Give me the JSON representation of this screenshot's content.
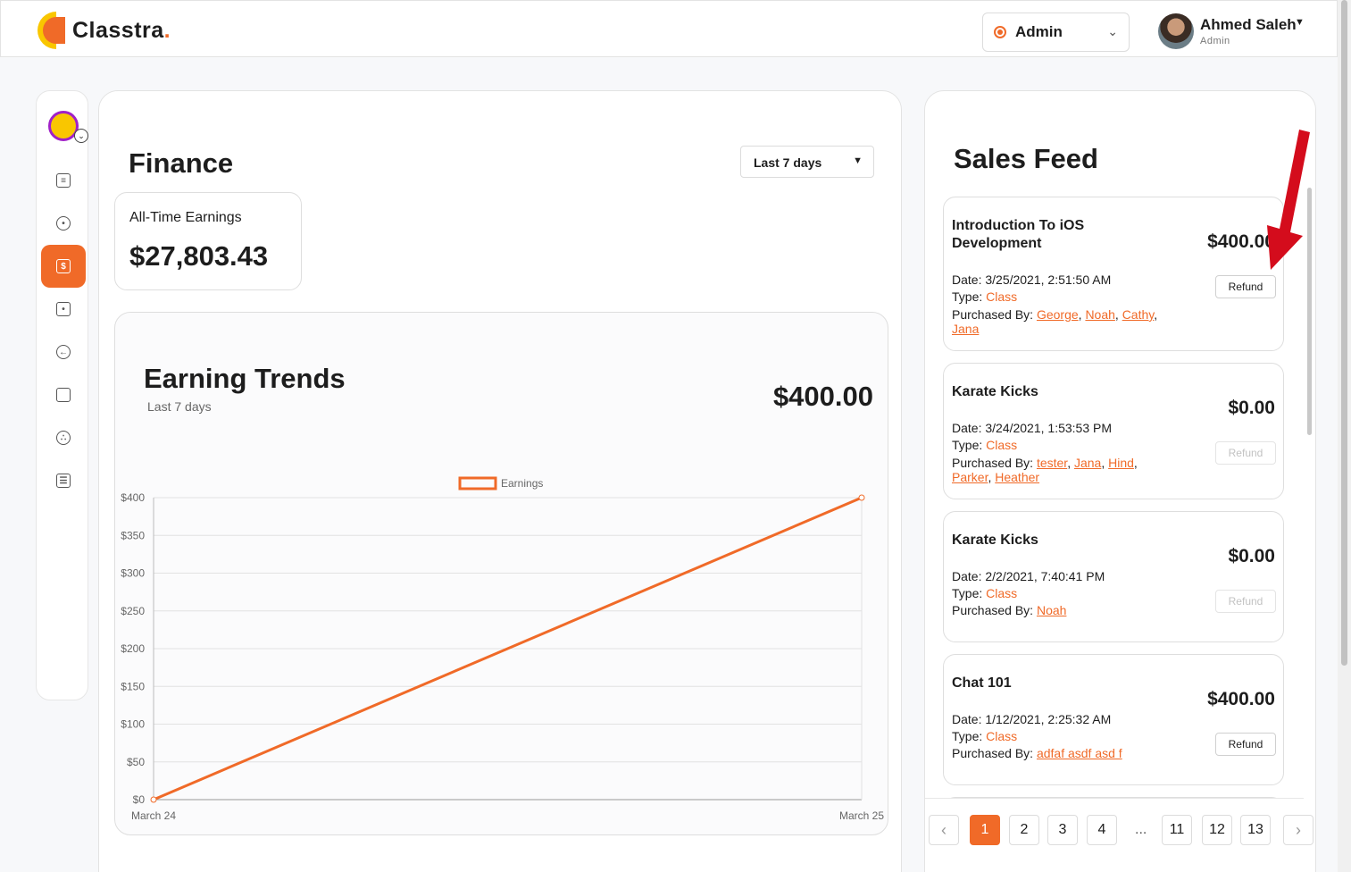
{
  "brand": {
    "name": "Classtra",
    "dot": ".",
    "accent": "#f06a28"
  },
  "header": {
    "role_select": {
      "value": "Admin"
    },
    "user": {
      "name": "Ahmed Saleh",
      "role": "Admin"
    }
  },
  "sidebar": {
    "items": [
      {
        "icon": "book-icon",
        "active": false
      },
      {
        "icon": "user-icon",
        "active": false
      },
      {
        "icon": "dollar-icon",
        "active": true
      },
      {
        "icon": "tag-icon",
        "active": false
      },
      {
        "icon": "logout-icon",
        "active": false
      },
      {
        "icon": "chat-icon",
        "active": false
      },
      {
        "icon": "face-icon",
        "active": false
      },
      {
        "icon": "settings-icon",
        "active": false
      }
    ]
  },
  "finance": {
    "title": "Finance",
    "range": "Last 7 days",
    "all_time": {
      "label": "All-Time Earnings",
      "value": "$27,803.43"
    },
    "trends": {
      "title": "Earning Trends",
      "subtitle": "Last 7 days",
      "total": "$400.00"
    }
  },
  "chart_data": {
    "type": "line",
    "legend": "Earnings",
    "x": [
      "March 24",
      "March 25"
    ],
    "series": [
      {
        "name": "Earnings",
        "values": [
          0,
          400
        ]
      }
    ],
    "y_ticks": [
      "$0",
      "$50",
      "$100",
      "$150",
      "$200",
      "$250",
      "$300",
      "$350",
      "$400"
    ],
    "ylim": [
      0,
      400
    ],
    "color": "#f06a28",
    "grid": true,
    "legend_position": "top-center"
  },
  "sales_feed": {
    "title": "Sales Feed",
    "items": [
      {
        "title": "Introduction To iOS Development",
        "amount": "$400.00",
        "date": "Date: 3/25/2021, 2:51:50 AM",
        "type_label": "Type:",
        "type": "Class",
        "purchased_label": "Purchased By:",
        "buyers": [
          "George",
          "Noah",
          "Cathy",
          "Jana"
        ],
        "refund": "Refund",
        "refund_enabled": true
      },
      {
        "title": "Karate Kicks",
        "amount": "$0.00",
        "date": "Date: 3/24/2021, 1:53:53 PM",
        "type_label": "Type:",
        "type": "Class",
        "purchased_label": "Purchased By:",
        "buyers": [
          "tester",
          "Jana",
          "Hind",
          "Parker",
          "Heather"
        ],
        "refund": "Refund",
        "refund_enabled": false
      },
      {
        "title": "Karate Kicks",
        "amount": "$0.00",
        "date": "Date: 2/2/2021, 7:40:41 PM",
        "type_label": "Type:",
        "type": "Class",
        "purchased_label": "Purchased By:",
        "buyers": [
          "Noah"
        ],
        "refund": "Refund",
        "refund_enabled": false
      },
      {
        "title": "Chat 101",
        "amount": "$400.00",
        "date": "Date: 1/12/2021, 2:25:32 AM",
        "type_label": "Type:",
        "type": "Class",
        "purchased_label": "Purchased By:",
        "buyers": [
          "adfaf asdf asd f"
        ],
        "refund": "Refund",
        "refund_enabled": true
      }
    ],
    "pagination": {
      "pages": [
        "1",
        "2",
        "3",
        "4",
        "...",
        "11",
        "12",
        "13"
      ],
      "current": "1",
      "prev": "‹",
      "next": "›"
    }
  }
}
